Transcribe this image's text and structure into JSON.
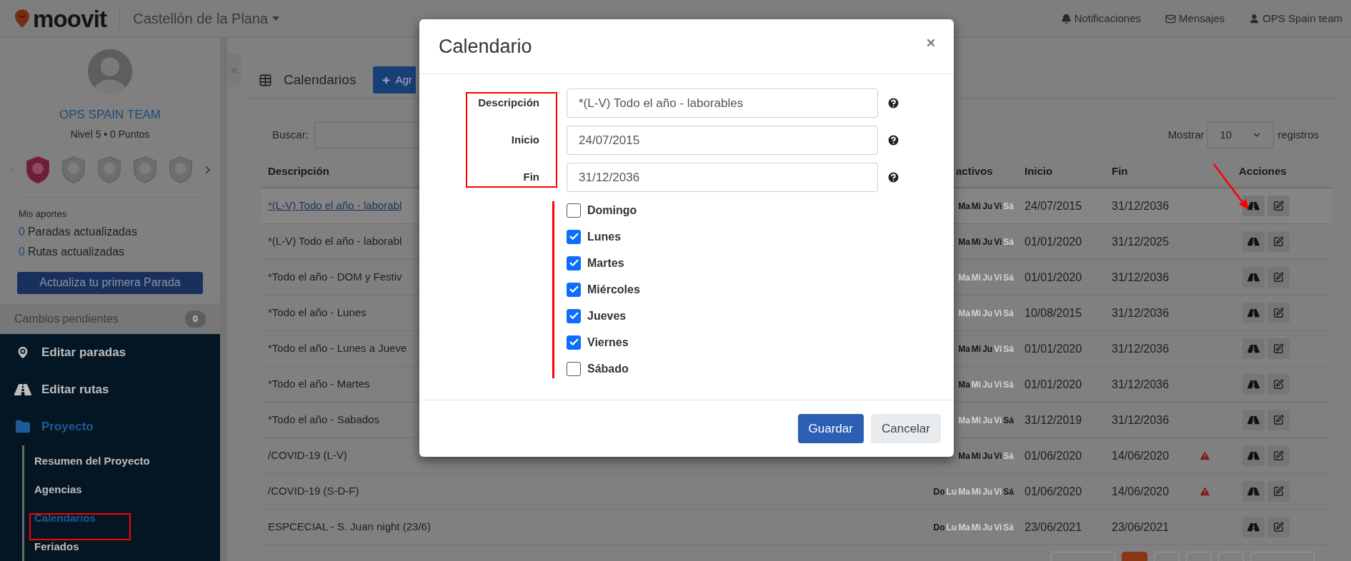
{
  "topbar": {
    "logo": "moovit",
    "city": "Castellón de la Plana",
    "links": [
      {
        "kind": "bell",
        "label": "Notificaciones"
      },
      {
        "kind": "envelope",
        "label": "Mensajes"
      },
      {
        "kind": "user",
        "label": "OPS Spain team"
      }
    ]
  },
  "sidebar": {
    "profile": {
      "name": "OPS SPAIN TEAM",
      "level": "Nivel 5 • 0 Puntos"
    },
    "badges": [
      {
        "earned": true
      },
      {
        "earned": false
      },
      {
        "earned": false
      },
      {
        "earned": false
      },
      {
        "earned": false
      }
    ],
    "contributions": {
      "title": "Mis aportes",
      "items": [
        {
          "count": "0",
          "label": "Paradas actualizadas"
        },
        {
          "count": "0",
          "label": "Rutas actualizadas"
        }
      ]
    },
    "cta": "Actualiza tu primera Parada",
    "pending": {
      "label": "Cambios pendientes",
      "count": "0"
    },
    "nav": [
      {
        "kind": "pin",
        "label": "Editar paradas",
        "selected": false
      },
      {
        "kind": "road",
        "label": "Editar rutas",
        "selected": false
      },
      {
        "kind": "folder",
        "label": "Proyecto",
        "selected": true,
        "expanded": true,
        "children": [
          {
            "label": "Resumen del Proyecto",
            "selected": false
          },
          {
            "label": "Agencias",
            "selected": false
          },
          {
            "label": "Calendarios",
            "selected": true
          },
          {
            "label": "Feriados",
            "selected": false
          }
        ]
      }
    ]
  },
  "page": {
    "title": "Calendarios",
    "add_button": "Agr",
    "search_label": "Buscar:",
    "show_label": "Mostrar",
    "page_size": "10",
    "show_suffix": "registros"
  },
  "table": {
    "headers": {
      "description": "Descripción",
      "days": "activos",
      "start": "Inicio",
      "end": "Fin",
      "actions": "Acciones"
    },
    "rows": [
      {
        "description": "*(L-V) Todo el año - laborabl",
        "selected": true,
        "days": [
          {
            "label": "Ma",
            "active": true
          },
          {
            "label": "Mi",
            "active": true
          },
          {
            "label": "Ju",
            "active": true
          },
          {
            "label": "Vi",
            "active": true
          },
          {
            "label": "Sá",
            "active": false
          }
        ],
        "start": "24/07/2015",
        "end": "31/12/2036",
        "warning": false
      },
      {
        "description": "*(L-V) Todo el año - laborabl",
        "selected": false,
        "days": [
          {
            "label": "Ma",
            "active": true
          },
          {
            "label": "Mi",
            "active": true
          },
          {
            "label": "Ju",
            "active": true
          },
          {
            "label": "Vi",
            "active": true
          },
          {
            "label": "Sá",
            "active": false
          }
        ],
        "start": "01/01/2020",
        "end": "31/12/2025",
        "warning": false
      },
      {
        "description": "*Todo el año - DOM y Festiv",
        "selected": false,
        "days": [
          {
            "label": "Ma",
            "active": false
          },
          {
            "label": "Mi",
            "active": false
          },
          {
            "label": "Ju",
            "active": false
          },
          {
            "label": "Vi",
            "active": false
          },
          {
            "label": "Sá",
            "active": false
          }
        ],
        "start": "01/01/2020",
        "end": "31/12/2036",
        "warning": false
      },
      {
        "description": "*Todo el año - Lunes",
        "selected": false,
        "days": [
          {
            "label": "Ma",
            "active": false
          },
          {
            "label": "Mi",
            "active": false
          },
          {
            "label": "Ju",
            "active": false
          },
          {
            "label": "Vi",
            "active": false
          },
          {
            "label": "Sá",
            "active": false
          }
        ],
        "start": "10/08/2015",
        "end": "31/12/2036",
        "warning": false
      },
      {
        "description": "*Todo el año - Lunes a Jueve",
        "selected": false,
        "days": [
          {
            "label": "Ma",
            "active": true
          },
          {
            "label": "Mi",
            "active": true
          },
          {
            "label": "Ju",
            "active": true
          },
          {
            "label": "Vi",
            "active": false
          },
          {
            "label": "Sá",
            "active": false
          }
        ],
        "start": "01/01/2020",
        "end": "31/12/2036",
        "warning": false
      },
      {
        "description": "*Todo el año - Martes",
        "selected": false,
        "days": [
          {
            "label": "Ma",
            "active": true
          },
          {
            "label": "Mi",
            "active": false
          },
          {
            "label": "Ju",
            "active": false
          },
          {
            "label": "Vi",
            "active": false
          },
          {
            "label": "Sá",
            "active": false
          }
        ],
        "start": "01/01/2020",
        "end": "31/12/2036",
        "warning": false
      },
      {
        "description": "*Todo el año - Sabados",
        "selected": false,
        "days": [
          {
            "label": "Ma",
            "active": false
          },
          {
            "label": "Mi",
            "active": false
          },
          {
            "label": "Ju",
            "active": false
          },
          {
            "label": "Vi",
            "active": false
          },
          {
            "label": "Sá",
            "active": true
          }
        ],
        "start": "31/12/2019",
        "end": "31/12/2036",
        "warning": false
      },
      {
        "description": "/COVID-19 (L-V)",
        "selected": false,
        "days": [
          {
            "label": "Ma",
            "active": true
          },
          {
            "label": "Mi",
            "active": true
          },
          {
            "label": "Ju",
            "active": true
          },
          {
            "label": "Vi",
            "active": true
          },
          {
            "label": "Sá",
            "active": false
          }
        ],
        "start": "01/06/2020",
        "end": "14/06/2020",
        "warning": true
      },
      {
        "description": "/COVID-19 (S-D-F)",
        "selected": false,
        "days": [
          {
            "label": "Do",
            "active": true
          },
          {
            "label": "Lu",
            "active": false
          },
          {
            "label": "Ma",
            "active": false
          },
          {
            "label": "Mi",
            "active": false
          },
          {
            "label": "Ju",
            "active": false
          },
          {
            "label": "Vi",
            "active": false
          },
          {
            "label": "Sá",
            "active": true
          }
        ],
        "start": "01/06/2020",
        "end": "14/06/2020",
        "warning": true
      },
      {
        "description": "ESPCECIAL - S. Juan night (23/6)",
        "selected": false,
        "days": [
          {
            "label": "Do",
            "active": true
          },
          {
            "label": "Lu",
            "active": false
          },
          {
            "label": "Ma",
            "active": false
          },
          {
            "label": "Mi",
            "active": false
          },
          {
            "label": "Ju",
            "active": false
          },
          {
            "label": "Vi",
            "active": false
          },
          {
            "label": "Sá",
            "active": false
          }
        ],
        "start": "23/06/2021",
        "end": "23/06/2021",
        "warning": false
      }
    ]
  },
  "pagination": [
    {
      "selected": false
    },
    {
      "selected": true
    },
    {
      "selected": false
    },
    {
      "selected": false
    },
    {
      "selected": false
    },
    {
      "selected": false
    }
  ],
  "modal": {
    "title": "Calendario",
    "fields": [
      {
        "label": "Descripción",
        "value": "*(L-V) Todo el año - laborables"
      },
      {
        "label": "Inicio",
        "value": "24/07/2015"
      },
      {
        "label": "Fin",
        "value": "31/12/2036"
      }
    ],
    "days": [
      {
        "label": "Domingo",
        "checked": false
      },
      {
        "label": "Lunes",
        "checked": true
      },
      {
        "label": "Martes",
        "checked": true
      },
      {
        "label": "Miércoles",
        "checked": true
      },
      {
        "label": "Jueves",
        "checked": true
      },
      {
        "label": "Viernes",
        "checked": true
      },
      {
        "label": "Sábado",
        "checked": false
      }
    ],
    "buttons": [
      {
        "kind": "primary",
        "label": "Guardar"
      },
      {
        "kind": "secondary",
        "label": "Cancelar"
      }
    ]
  }
}
